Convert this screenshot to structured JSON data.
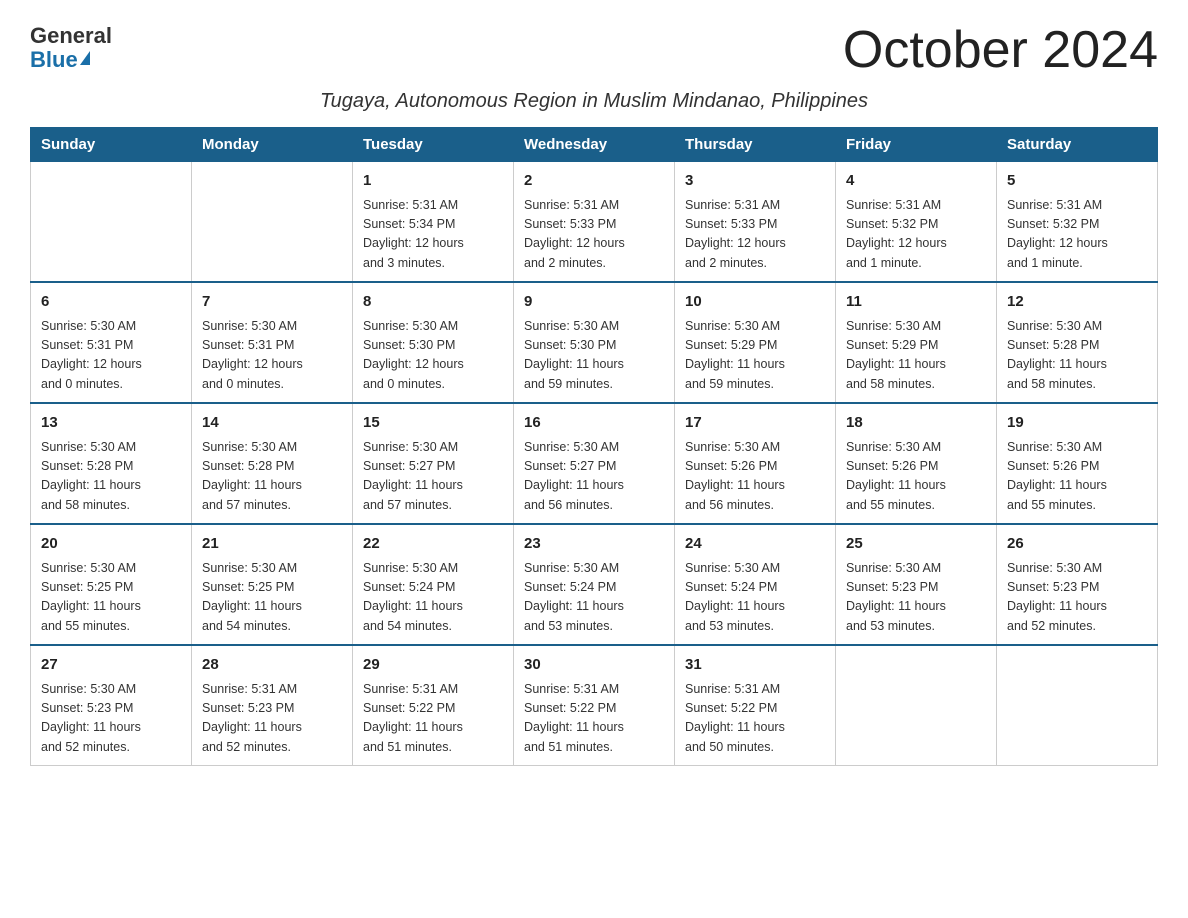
{
  "header": {
    "logo_general": "General",
    "logo_blue": "Blue",
    "month_title": "October 2024",
    "subtitle": "Tugaya, Autonomous Region in Muslim Mindanao, Philippines"
  },
  "weekdays": [
    "Sunday",
    "Monday",
    "Tuesday",
    "Wednesday",
    "Thursday",
    "Friday",
    "Saturday"
  ],
  "weeks": [
    [
      {
        "day": "",
        "info": ""
      },
      {
        "day": "",
        "info": ""
      },
      {
        "day": "1",
        "info": "Sunrise: 5:31 AM\nSunset: 5:34 PM\nDaylight: 12 hours\nand 3 minutes."
      },
      {
        "day": "2",
        "info": "Sunrise: 5:31 AM\nSunset: 5:33 PM\nDaylight: 12 hours\nand 2 minutes."
      },
      {
        "day": "3",
        "info": "Sunrise: 5:31 AM\nSunset: 5:33 PM\nDaylight: 12 hours\nand 2 minutes."
      },
      {
        "day": "4",
        "info": "Sunrise: 5:31 AM\nSunset: 5:32 PM\nDaylight: 12 hours\nand 1 minute."
      },
      {
        "day": "5",
        "info": "Sunrise: 5:31 AM\nSunset: 5:32 PM\nDaylight: 12 hours\nand 1 minute."
      }
    ],
    [
      {
        "day": "6",
        "info": "Sunrise: 5:30 AM\nSunset: 5:31 PM\nDaylight: 12 hours\nand 0 minutes."
      },
      {
        "day": "7",
        "info": "Sunrise: 5:30 AM\nSunset: 5:31 PM\nDaylight: 12 hours\nand 0 minutes."
      },
      {
        "day": "8",
        "info": "Sunrise: 5:30 AM\nSunset: 5:30 PM\nDaylight: 12 hours\nand 0 minutes."
      },
      {
        "day": "9",
        "info": "Sunrise: 5:30 AM\nSunset: 5:30 PM\nDaylight: 11 hours\nand 59 minutes."
      },
      {
        "day": "10",
        "info": "Sunrise: 5:30 AM\nSunset: 5:29 PM\nDaylight: 11 hours\nand 59 minutes."
      },
      {
        "day": "11",
        "info": "Sunrise: 5:30 AM\nSunset: 5:29 PM\nDaylight: 11 hours\nand 58 minutes."
      },
      {
        "day": "12",
        "info": "Sunrise: 5:30 AM\nSunset: 5:28 PM\nDaylight: 11 hours\nand 58 minutes."
      }
    ],
    [
      {
        "day": "13",
        "info": "Sunrise: 5:30 AM\nSunset: 5:28 PM\nDaylight: 11 hours\nand 58 minutes."
      },
      {
        "day": "14",
        "info": "Sunrise: 5:30 AM\nSunset: 5:28 PM\nDaylight: 11 hours\nand 57 minutes."
      },
      {
        "day": "15",
        "info": "Sunrise: 5:30 AM\nSunset: 5:27 PM\nDaylight: 11 hours\nand 57 minutes."
      },
      {
        "day": "16",
        "info": "Sunrise: 5:30 AM\nSunset: 5:27 PM\nDaylight: 11 hours\nand 56 minutes."
      },
      {
        "day": "17",
        "info": "Sunrise: 5:30 AM\nSunset: 5:26 PM\nDaylight: 11 hours\nand 56 minutes."
      },
      {
        "day": "18",
        "info": "Sunrise: 5:30 AM\nSunset: 5:26 PM\nDaylight: 11 hours\nand 55 minutes."
      },
      {
        "day": "19",
        "info": "Sunrise: 5:30 AM\nSunset: 5:26 PM\nDaylight: 11 hours\nand 55 minutes."
      }
    ],
    [
      {
        "day": "20",
        "info": "Sunrise: 5:30 AM\nSunset: 5:25 PM\nDaylight: 11 hours\nand 55 minutes."
      },
      {
        "day": "21",
        "info": "Sunrise: 5:30 AM\nSunset: 5:25 PM\nDaylight: 11 hours\nand 54 minutes."
      },
      {
        "day": "22",
        "info": "Sunrise: 5:30 AM\nSunset: 5:24 PM\nDaylight: 11 hours\nand 54 minutes."
      },
      {
        "day": "23",
        "info": "Sunrise: 5:30 AM\nSunset: 5:24 PM\nDaylight: 11 hours\nand 53 minutes."
      },
      {
        "day": "24",
        "info": "Sunrise: 5:30 AM\nSunset: 5:24 PM\nDaylight: 11 hours\nand 53 minutes."
      },
      {
        "day": "25",
        "info": "Sunrise: 5:30 AM\nSunset: 5:23 PM\nDaylight: 11 hours\nand 53 minutes."
      },
      {
        "day": "26",
        "info": "Sunrise: 5:30 AM\nSunset: 5:23 PM\nDaylight: 11 hours\nand 52 minutes."
      }
    ],
    [
      {
        "day": "27",
        "info": "Sunrise: 5:30 AM\nSunset: 5:23 PM\nDaylight: 11 hours\nand 52 minutes."
      },
      {
        "day": "28",
        "info": "Sunrise: 5:31 AM\nSunset: 5:23 PM\nDaylight: 11 hours\nand 52 minutes."
      },
      {
        "day": "29",
        "info": "Sunrise: 5:31 AM\nSunset: 5:22 PM\nDaylight: 11 hours\nand 51 minutes."
      },
      {
        "day": "30",
        "info": "Sunrise: 5:31 AM\nSunset: 5:22 PM\nDaylight: 11 hours\nand 51 minutes."
      },
      {
        "day": "31",
        "info": "Sunrise: 5:31 AM\nSunset: 5:22 PM\nDaylight: 11 hours\nand 50 minutes."
      },
      {
        "day": "",
        "info": ""
      },
      {
        "day": "",
        "info": ""
      }
    ]
  ]
}
